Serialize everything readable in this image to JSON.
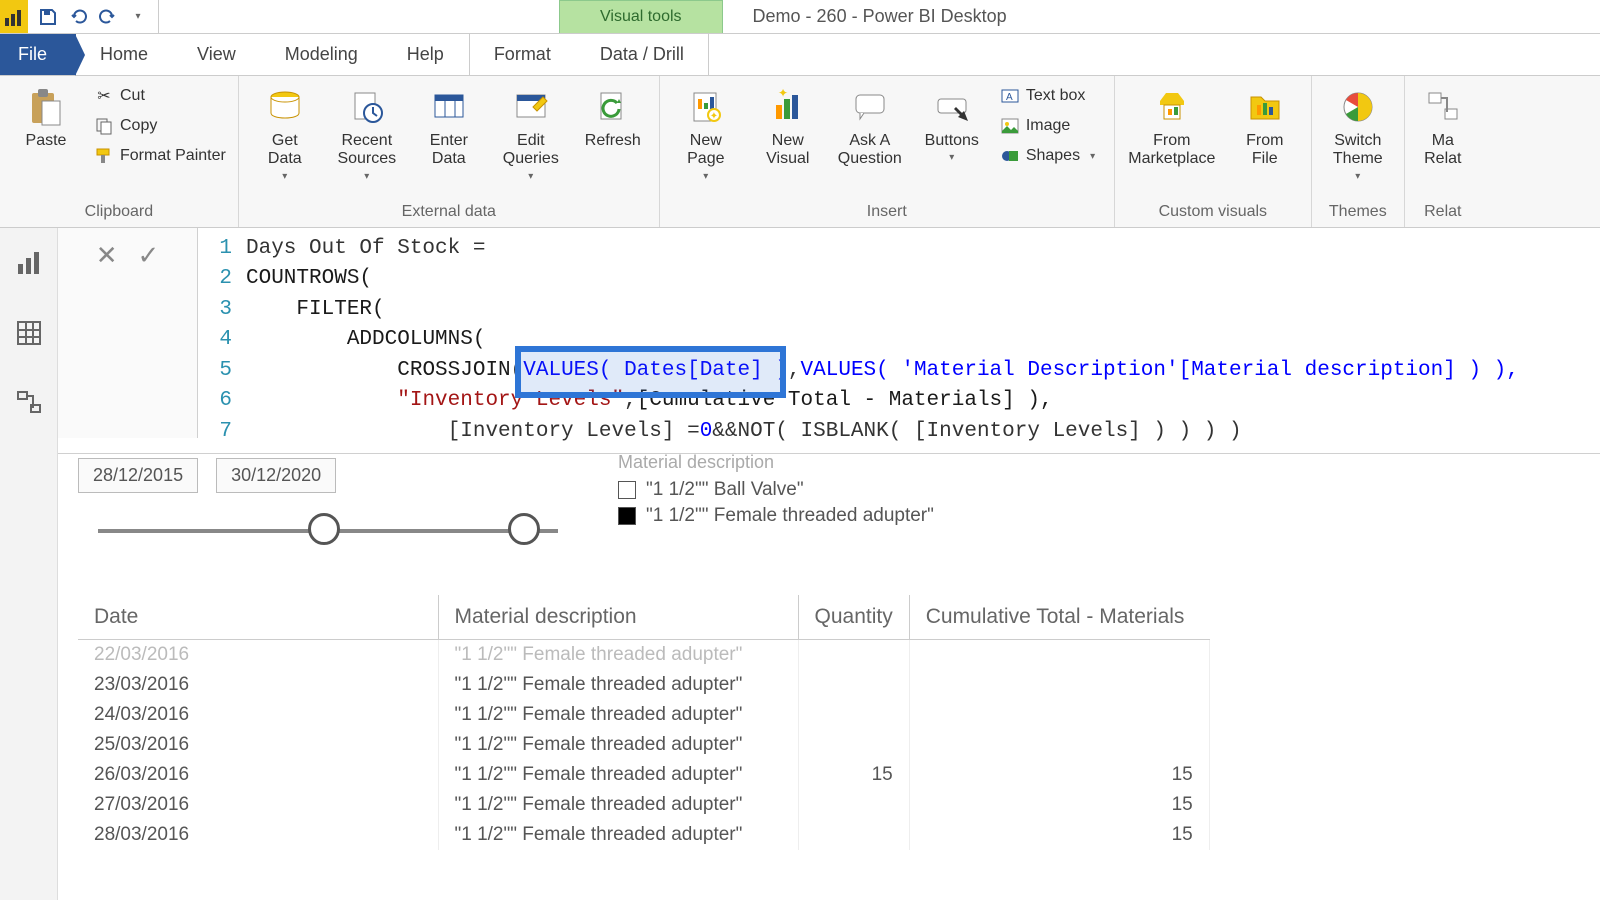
{
  "window": {
    "contextual_label": "Visual tools",
    "title": "Demo - 260 - Power BI Desktop"
  },
  "tabs": {
    "file": "File",
    "home": "Home",
    "view": "View",
    "modeling": "Modeling",
    "help": "Help",
    "format": "Format",
    "datadrill": "Data / Drill"
  },
  "ribbon": {
    "clipboard": {
      "label": "Clipboard",
      "paste": "Paste",
      "cut": "Cut",
      "copy": "Copy",
      "format_painter": "Format Painter"
    },
    "external": {
      "label": "External data",
      "get_data": "Get\nData",
      "recent_sources": "Recent\nSources",
      "enter_data": "Enter\nData",
      "edit_queries": "Edit\nQueries",
      "refresh": "Refresh"
    },
    "insert": {
      "label": "Insert",
      "new_page": "New\nPage",
      "new_visual": "New\nVisual",
      "ask": "Ask A\nQuestion",
      "buttons": "Buttons",
      "textbox": "Text box",
      "image": "Image",
      "shapes": "Shapes"
    },
    "custom": {
      "label": "Custom visuals",
      "marketplace": "From\nMarketplace",
      "file": "From\nFile"
    },
    "themes": {
      "label": "Themes",
      "switch": "Switch\nTheme"
    },
    "relat": {
      "label": "Relat",
      "ma": "Ma\nRelat"
    }
  },
  "formula": {
    "l1": "Days Out Of Stock =",
    "l2": "COUNTROWS(",
    "l3_indent": "    ",
    "l3": "FILTER(",
    "l4_indent": "        ",
    "l4": "ADDCOLUMNS(",
    "l5_indent": "            ",
    "l5a": "CROSSJOIN(",
    "l5b": " VALUES( Dates[Date] )",
    "l5c": ", ",
    "l5d": "VALUES( 'Material Description'[Material description] ) ),",
    "l6_indent": "            ",
    "l6a": "\"Inventory Levels\"",
    "l6b": ", ",
    "l6c": "[Cumulative Total - Materials] ),",
    "l7_indent": "                ",
    "l7a": "[Inventory Levels] = ",
    "l7b": "0",
    "l7c": " && ",
    "l7d": "NOT( ISBLANK( [Inventory Levels] ) ) ) )"
  },
  "slicer": {
    "date_from": "28/12/2015",
    "date_to": "30/12/2020",
    "legend_title": "Material description",
    "legend_items": [
      {
        "label": "\"1 1/2\"\" Ball Valve\"",
        "filled": false
      },
      {
        "label": "\"1 1/2\"\" Female threaded adupter\"",
        "filled": true
      }
    ]
  },
  "table": {
    "headers": [
      "Date",
      "Material description",
      "Quantity",
      "Cumulative Total - Materials"
    ],
    "rows": [
      {
        "date": "22/03/2016",
        "mat": "\"1 1/2\"\" Female threaded adupter\"",
        "qty": "",
        "cum": "",
        "cut": true
      },
      {
        "date": "23/03/2016",
        "mat": "\"1 1/2\"\" Female threaded adupter\"",
        "qty": "",
        "cum": ""
      },
      {
        "date": "24/03/2016",
        "mat": "\"1 1/2\"\" Female threaded adupter\"",
        "qty": "",
        "cum": ""
      },
      {
        "date": "25/03/2016",
        "mat": "\"1 1/2\"\" Female threaded adupter\"",
        "qty": "",
        "cum": ""
      },
      {
        "date": "26/03/2016",
        "mat": "\"1 1/2\"\" Female threaded adupter\"",
        "qty": "15",
        "cum": "15"
      },
      {
        "date": "27/03/2016",
        "mat": "\"1 1/2\"\" Female threaded adupter\"",
        "qty": "",
        "cum": "15"
      },
      {
        "date": "28/03/2016",
        "mat": "\"1 1/2\"\" Female threaded adupter\"",
        "qty": "",
        "cum": "15"
      }
    ]
  }
}
